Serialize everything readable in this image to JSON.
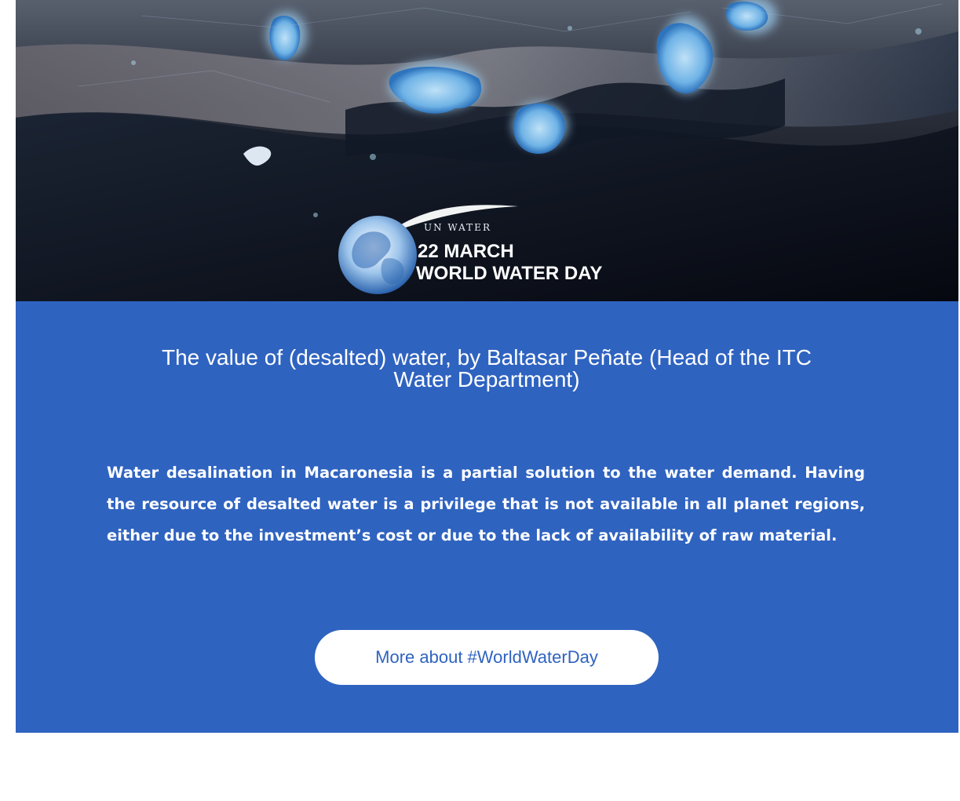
{
  "hero": {
    "brand_line": "UN WATER",
    "date_line": "22 MARCH",
    "event_line": "WORLD WATER DAY"
  },
  "article": {
    "title": "The value of (desalted) water, by Baltasar Peñate (Head of the ITC Water Department)",
    "lead": "Water desalination in Macaronesia is a partial solution to the water demand. Having the resource of desalted water is a privilege that is not available in all planet regions, either due to the investment’s cost or due to the lack of availability of raw material."
  },
  "cta": {
    "label": "More about #WorldWaterDay"
  },
  "colors": {
    "content_background": "#2f63c0",
    "button_background": "#ffffff",
    "button_text": "#2f63c0"
  },
  "icons": {
    "hero_logo": "globe-icon"
  }
}
